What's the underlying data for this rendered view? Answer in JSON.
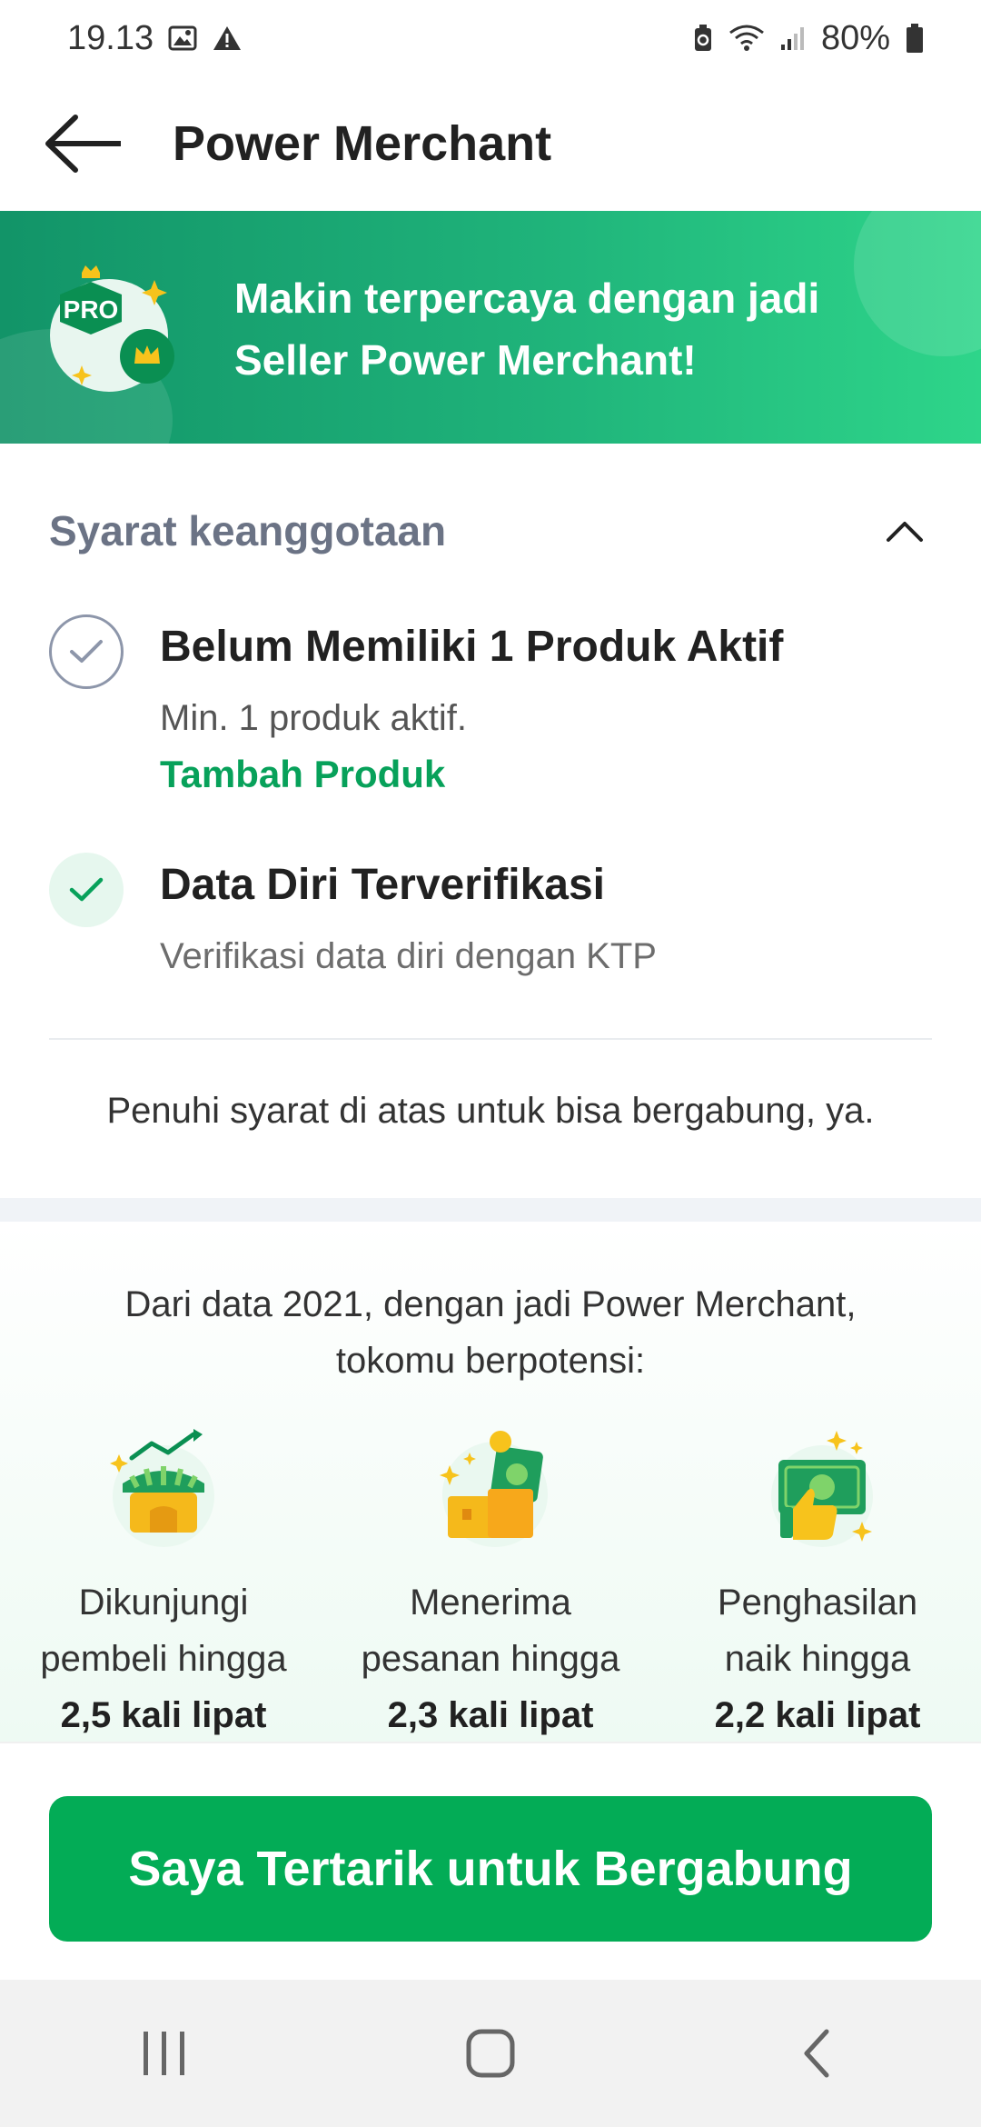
{
  "status_bar": {
    "time": "19.13",
    "battery": "80%",
    "icons": [
      "image-icon",
      "warning-icon",
      "battery-saver-icon",
      "wifi-icon",
      "signal-icon",
      "battery-icon"
    ]
  },
  "app_bar": {
    "title": "Power Merchant",
    "back_icon": "arrow-left-icon"
  },
  "banner": {
    "line1": "Makin terpercaya dengan jadi",
    "line2": "Seller Power Merchant!",
    "badge_label": "PRO"
  },
  "membership": {
    "title": "Syarat keanggotaan",
    "expanded": true,
    "requirements": [
      {
        "title": "Belum Memiliki 1 Produk Aktif",
        "description": "Min. 1 produk aktif.",
        "link": "Tambah Produk",
        "status": "pending"
      },
      {
        "title": "Data Diri Terverifikasi",
        "description": "Verifikasi data diri dengan KTP",
        "status": "done"
      }
    ],
    "note": "Penuhi syarat di atas untuk bisa bergabung, ya."
  },
  "benefits": {
    "intro_line1": "Dari data 2021, dengan jadi Power Merchant,",
    "intro_line2": "tokomu berpotensi:",
    "items": [
      {
        "line1": "Dikunjungi",
        "line2": "pembeli hingga",
        "highlight": "2,5 kali lipat",
        "icon": "shop-growth-icon"
      },
      {
        "line1": "Menerima",
        "line2": "pesanan hingga",
        "highlight": "2,3 kali lipat",
        "icon": "orders-money-icon"
      },
      {
        "line1": "Penghasilan",
        "line2": "naik hingga",
        "highlight": "2,2 kali lipat",
        "icon": "income-thumbs-up-icon"
      }
    ]
  },
  "cta": {
    "label": "Saya Tertarik untuk Bergabung"
  },
  "colors": {
    "primary_green": "#03ac56",
    "link_green": "#07a15a",
    "section_title_gray": "#6b7385"
  }
}
